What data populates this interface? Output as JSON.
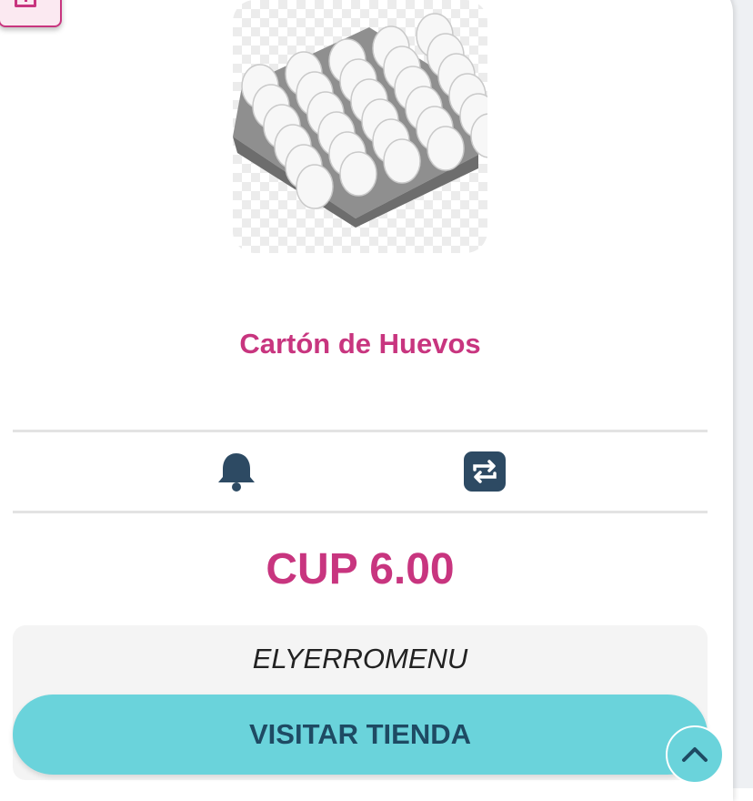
{
  "product": {
    "name": "Cartón de Huevos",
    "image_alt": "egg-carton-photo",
    "price": "CUP 6.00"
  },
  "actions": {
    "notify_icon": "bell-icon",
    "compare_icon": "swap-icon"
  },
  "store": {
    "name": "ELYERROMENU",
    "visit_label": "VISITAR TIENDA"
  },
  "colors": {
    "accent": "#c8357f",
    "button": "#6ad3db",
    "button_text": "#1e4a63",
    "icon": "#2d4a63"
  }
}
